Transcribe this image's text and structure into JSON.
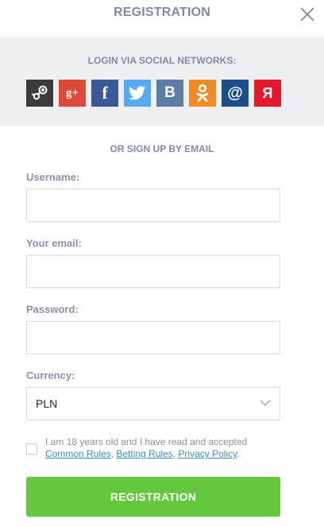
{
  "header": {
    "title": "REGISTRATION",
    "close_icon": "close-icon"
  },
  "social": {
    "title": "LOGIN VIA SOCIAL NETWORKS:",
    "buttons": [
      {
        "name": "steam",
        "icon": "steam-icon",
        "color": "#3b3b3b"
      },
      {
        "name": "google-plus",
        "icon": "google-plus-icon",
        "label": "g+",
        "color": "#dc4a38"
      },
      {
        "name": "facebook",
        "icon": "facebook-icon",
        "label": "f",
        "color": "#3b5998"
      },
      {
        "name": "twitter",
        "icon": "twitter-icon",
        "color": "#55acee"
      },
      {
        "name": "vkontakte",
        "icon": "vk-icon",
        "label": "B",
        "color": "#5a7ea6"
      },
      {
        "name": "odnoklassniki",
        "icon": "odnoklassniki-icon",
        "color": "#ef8c26"
      },
      {
        "name": "mail-ru",
        "icon": "at-icon",
        "label": "@",
        "color": "#1b4f8a"
      },
      {
        "name": "yandex",
        "icon": "yandex-icon",
        "label": "Я",
        "color": "#e21a2b"
      }
    ]
  },
  "email_section": {
    "title": "OR SIGN UP BY EMAIL"
  },
  "form": {
    "username_label": "Username:",
    "username_value": "",
    "email_label": "Your email:",
    "email_value": "",
    "password_label": "Password:",
    "password_value": "",
    "currency_label": "Currency:",
    "currency_value": "PLN"
  },
  "agreement": {
    "text": "I am 18 years old and I have read and accepted",
    "link1": "Common Rules",
    "sep1": ", ",
    "link2": "Betting Rules",
    "sep2": ", ",
    "link3": "Privacy Policy",
    "end": ".",
    "checked": false
  },
  "submit": {
    "label": "REGISTRATION",
    "color": "#64c83e"
  }
}
